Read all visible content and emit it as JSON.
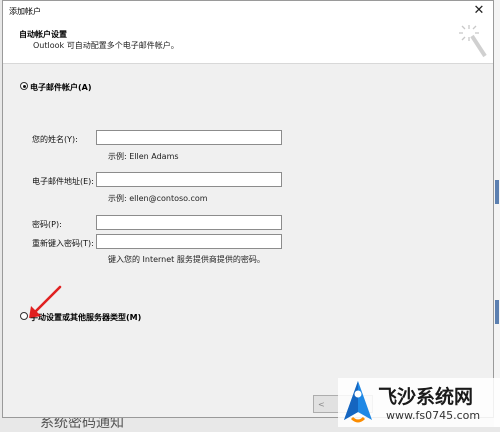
{
  "window": {
    "title": "添加帐户",
    "close_glyph": "✕"
  },
  "header": {
    "title": "自动帐户设置",
    "subtitle": "Outlook 可自动配置多个电子邮件帐户。",
    "icon": "magic-wand-icon"
  },
  "email_option": {
    "label": "电子邮件帐户(A)",
    "selected": true,
    "fields": [
      {
        "label": "您的姓名(Y):",
        "value": "",
        "hint": "示例: Ellen Adams"
      },
      {
        "label": "电子邮件地址(E):",
        "value": "",
        "hint": "示例: ellen@contoso.com"
      },
      {
        "label": "密码(P):",
        "value": "",
        "hint": ""
      },
      {
        "label": "重新键入密码(T):",
        "value": "",
        "hint": "键入您的 Internet 服务提供商提供的密码。"
      }
    ]
  },
  "manual_option": {
    "label": "手动设置或其他服务器类型(M)",
    "selected": false
  },
  "buttons": {
    "back_label": "<"
  },
  "background": {
    "bottom_text": "系统密码通知"
  },
  "watermark": {
    "brand": "飞沙系统网",
    "url": "www.fs0745.com"
  },
  "colors": {
    "arrow": "#e02020",
    "body_bg": "#f0f0f0",
    "logo_blue": "#1e88e5"
  }
}
